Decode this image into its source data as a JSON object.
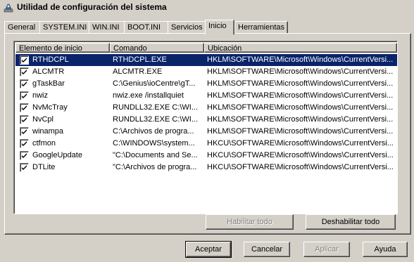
{
  "window": {
    "title": "Utilidad de configuración del sistema"
  },
  "tabs": [
    {
      "label": "General",
      "active": false
    },
    {
      "label": "SYSTEM.INI",
      "active": false
    },
    {
      "label": "WIN.INI",
      "active": false
    },
    {
      "label": "BOOT.INI",
      "active": false
    },
    {
      "label": "Servicios",
      "active": false
    },
    {
      "label": "Inicio",
      "active": true
    },
    {
      "label": "Herramientas",
      "active": false
    }
  ],
  "list": {
    "columns": [
      "Elemento de inicio",
      "Comando",
      "Ubicación"
    ],
    "rows": [
      {
        "checked": true,
        "name": "RTHDCPL",
        "command": "RTHDCPL.EXE",
        "location": "HKLM\\SOFTWARE\\Microsoft\\Windows\\CurrentVersi...",
        "selected": true
      },
      {
        "checked": true,
        "name": "ALCMTR",
        "command": "ALCMTR.EXE",
        "location": "HKLM\\SOFTWARE\\Microsoft\\Windows\\CurrentVersi..."
      },
      {
        "checked": true,
        "name": "gTaskBar",
        "command": "C:\\Genius\\ioCentre\\gT...",
        "location": "HKLM\\SOFTWARE\\Microsoft\\Windows\\CurrentVersi..."
      },
      {
        "checked": true,
        "name": "nwiz",
        "command": "nwiz.exe /installquiet",
        "location": "HKLM\\SOFTWARE\\Microsoft\\Windows\\CurrentVersi..."
      },
      {
        "checked": true,
        "name": "NvMcTray",
        "command": "RUNDLL32.EXE C:\\WI...",
        "location": "HKLM\\SOFTWARE\\Microsoft\\Windows\\CurrentVersi..."
      },
      {
        "checked": true,
        "name": "NvCpl",
        "command": "RUNDLL32.EXE C:\\WI...",
        "location": "HKLM\\SOFTWARE\\Microsoft\\Windows\\CurrentVersi..."
      },
      {
        "checked": true,
        "name": "winampa",
        "command": "C:\\Archivos de progra...",
        "location": "HKLM\\SOFTWARE\\Microsoft\\Windows\\CurrentVersi..."
      },
      {
        "checked": true,
        "name": "ctfmon",
        "command": "C:\\WINDOWS\\system...",
        "location": "HKCU\\SOFTWARE\\Microsoft\\Windows\\CurrentVersi..."
      },
      {
        "checked": true,
        "name": "GoogleUpdate",
        "command": "\"C:\\Documents and Se...",
        "location": "HKCU\\SOFTWARE\\Microsoft\\Windows\\CurrentVersi..."
      },
      {
        "checked": true,
        "name": "DTLite",
        "command": "\"C:\\Archivos de progra...",
        "location": "HKCU\\SOFTWARE\\Microsoft\\Windows\\CurrentVersi..."
      }
    ]
  },
  "panel_buttons": {
    "enable_all": "Habilitar todo",
    "disable_all": "Deshabilitar todo"
  },
  "dialog_buttons": {
    "ok": "Aceptar",
    "cancel": "Cancelar",
    "apply": "Aplicar",
    "help": "Ayuda"
  }
}
